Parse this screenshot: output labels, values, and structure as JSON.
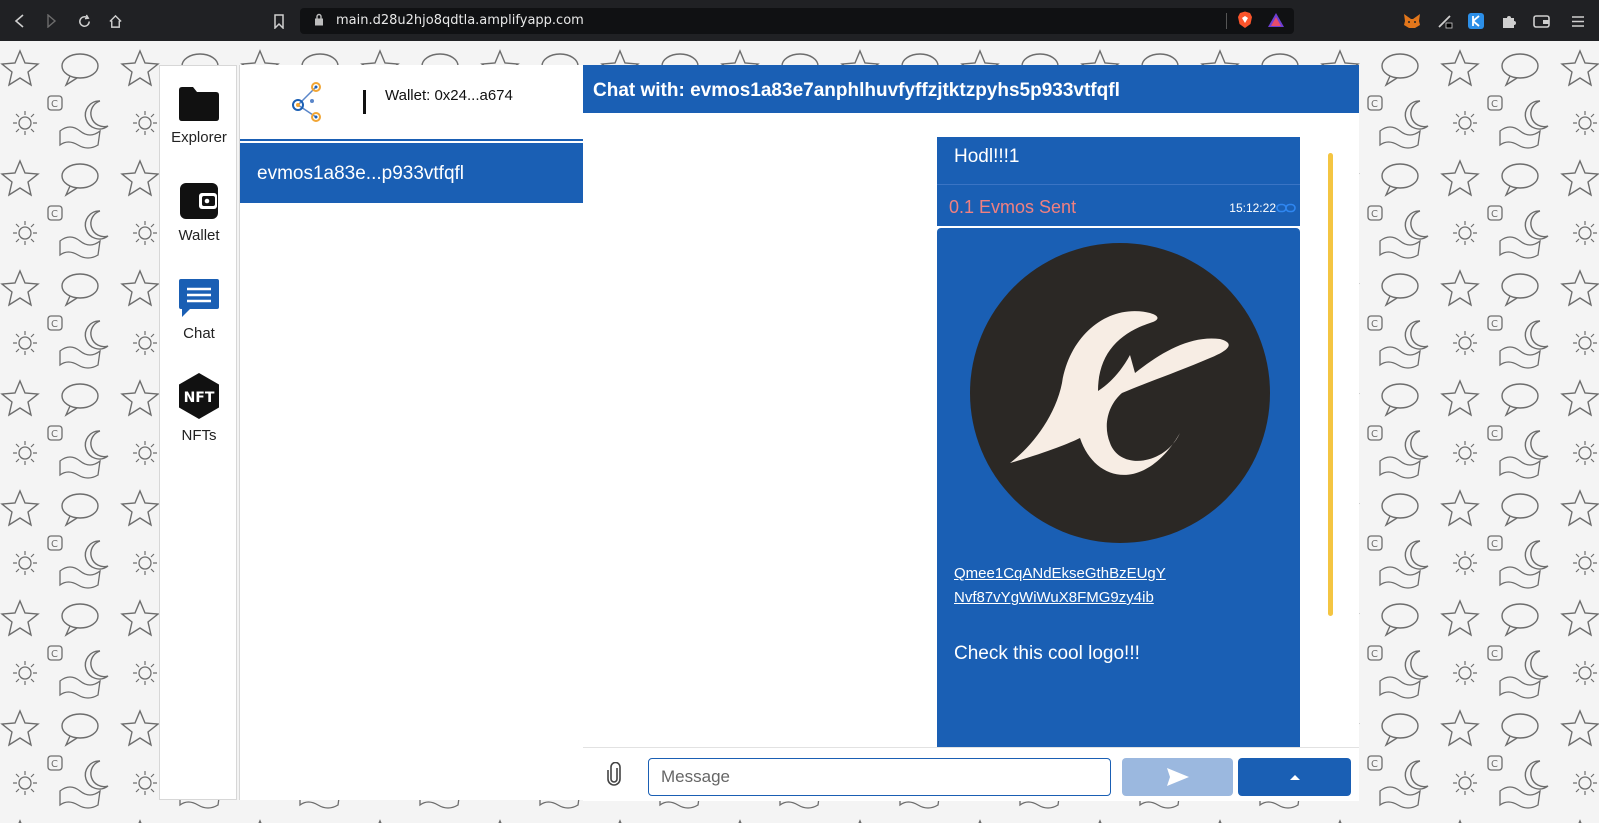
{
  "browser": {
    "url": "main.d28u2hjo8qdtla.amplifyapp.com",
    "nav_icons": [
      "back-icon",
      "forward-icon",
      "reload-icon",
      "home-icon",
      "bookmark-icon"
    ],
    "extension_icons": [
      "brave-shield-icon",
      "brave-rewards-icon",
      "metamask-icon",
      "pen-icon",
      "keplr-icon",
      "extensions-icon",
      "wallet-icon",
      "menu-icon"
    ]
  },
  "sidebar": {
    "items": [
      {
        "label": "Explorer",
        "icon": "folder-icon"
      },
      {
        "label": "Wallet",
        "icon": "wallet-icon"
      },
      {
        "label": "Chat",
        "icon": "chat-icon"
      },
      {
        "label": "NFTs",
        "icon": "nft-icon"
      }
    ]
  },
  "contacts": {
    "wallet_label": "Wallet: 0x24...a674",
    "items": [
      {
        "label": "evmos1a83e...p933vtfqfl",
        "selected": true
      }
    ]
  },
  "chat": {
    "title": "Chat with: evmos1a83e7anphlhuvfyffzjtktzpyhs5p933vtfqfl",
    "messages": [
      {
        "text": "Hodl!!!1",
        "tx_label": "0.1 Evmos Sent",
        "time": "15:12:22"
      },
      {
        "link_line1": "Qmee1CqANdEkseGthBzEUgY",
        "link_line2": "Nvf87vYgWiWuX8FMG9zy4ib",
        "text": "Check this cool logo!!!"
      }
    ],
    "input_placeholder": "Message",
    "input_value": ""
  },
  "colors": {
    "accent": "#1a5fb4",
    "tx_sent": "#f08080",
    "scroll_indicator": "#f4c542",
    "logo_dark": "#2b2825",
    "logo_light": "#f7ede4"
  }
}
